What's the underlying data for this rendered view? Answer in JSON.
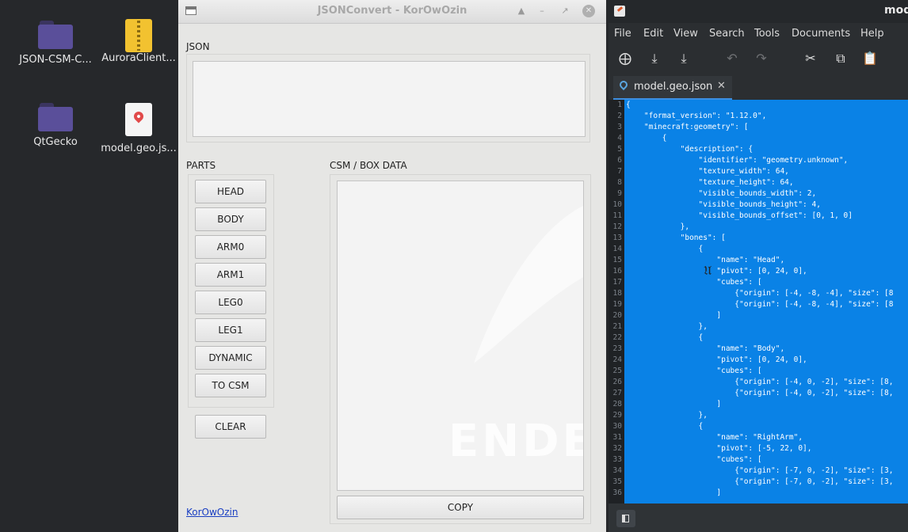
{
  "desktop": {
    "icons": [
      {
        "label": "JSON-CSM-C...",
        "type": "folder"
      },
      {
        "label": "AuroraClient...",
        "type": "zip-archive"
      },
      {
        "label": "QtGecko",
        "type": "folder"
      },
      {
        "label": "model.geo.js...",
        "type": "geo-json-file"
      }
    ]
  },
  "jsonconvert": {
    "title": "JSONConvert - KorOwOzin",
    "json_label": "JSON",
    "parts_label": "PARTS",
    "csm_label": "CSM / BOX DATA",
    "parts_buttons": [
      "HEAD",
      "BODY",
      "ARM0",
      "ARM1",
      "LEG0",
      "LEG1",
      "DYNAMIC",
      "TO CSM"
    ],
    "clear_label": "CLEAR",
    "copy_label": "COPY",
    "watermark": "ENDEAVO",
    "author_link": "KorOwOzin"
  },
  "editor": {
    "title": "mod",
    "menu": [
      "File",
      "Edit",
      "View",
      "Search",
      "Tools",
      "Documents",
      "Help"
    ],
    "tab_name": "model.geo.json",
    "lines": [
      "{",
      "    \"format_version\": \"1.12.0\",",
      "    \"minecraft:geometry\": [",
      "        {",
      "            \"description\": {",
      "                \"identifier\": \"geometry.unknown\",",
      "                \"texture_width\": 64,",
      "                \"texture_height\": 64,",
      "                \"visible_bounds_width\": 2,",
      "                \"visible_bounds_height\": 4,",
      "                \"visible_bounds_offset\": [0, 1, 0]",
      "            },",
      "            \"bones\": [",
      "                {",
      "                    \"name\": \"Head\",",
      "                    \"pivot\": [0, 24, 0],",
      "                    \"cubes\": [",
      "                        {\"origin\": [-4, -8, -4], \"size\": [8",
      "                        {\"origin\": [-4, -8, -4], \"size\": [8",
      "                    ]",
      "                },",
      "                {",
      "                    \"name\": \"Body\",",
      "                    \"pivot\": [0, 24, 0],",
      "                    \"cubes\": [",
      "                        {\"origin\": [-4, 0, -2], \"size\": [8,",
      "                        {\"origin\": [-4, 0, -2], \"size\": [8,",
      "                    ]",
      "                },",
      "                {",
      "                    \"name\": \"RightArm\",",
      "                    \"pivot\": [-5, 22, 0],",
      "                    \"cubes\": [",
      "                        {\"origin\": [-7, 0, -2], \"size\": [3,",
      "                        {\"origin\": [-7, 0, -2], \"size\": [3,",
      "                    ]"
    ]
  },
  "colors": {
    "selection": "#0a82e6",
    "desktop_bg": "#26282b",
    "window_bg": "#e6e6e4"
  }
}
